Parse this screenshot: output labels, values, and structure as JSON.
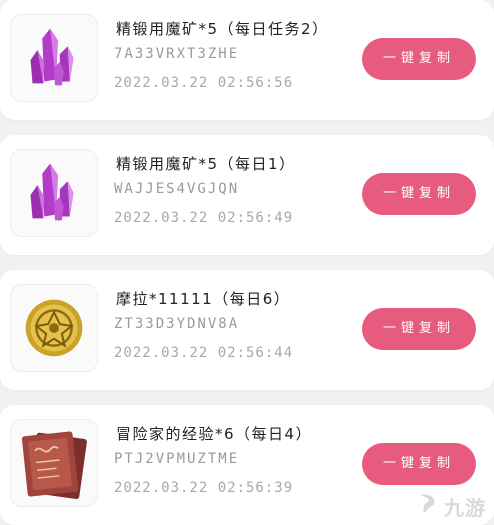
{
  "items": [
    {
      "title": "精锻用魔矿*5（每日任务2）",
      "code": "7A33VRXT3ZHE",
      "time": "2022.03.22 02:56:56",
      "icon": "purple-crystal-icon",
      "button_label": "一键复制"
    },
    {
      "title": "精锻用魔矿*5（每日1）",
      "code": "WAJJES4VGJQN",
      "time": "2022.03.22 02:56:49",
      "icon": "purple-crystal-icon",
      "button_label": "一键复制"
    },
    {
      "title": "摩拉*11111（每日6）",
      "code": "ZT33D3YDNV8A",
      "time": "2022.03.22 02:56:44",
      "icon": "mora-coin-icon",
      "button_label": "一键复制"
    },
    {
      "title": "冒险家的经验*6（每日4）",
      "code": "PTJ2VPMUZTME",
      "time": "2022.03.22 02:56:39",
      "icon": "adventurer-book-icon",
      "button_label": "一键复制"
    }
  ],
  "watermark": {
    "text": "九游",
    "icon": "jiuyou-logo-icon"
  },
  "colors": {
    "accent": "#e75c7e",
    "background": "#f1f1f1"
  }
}
